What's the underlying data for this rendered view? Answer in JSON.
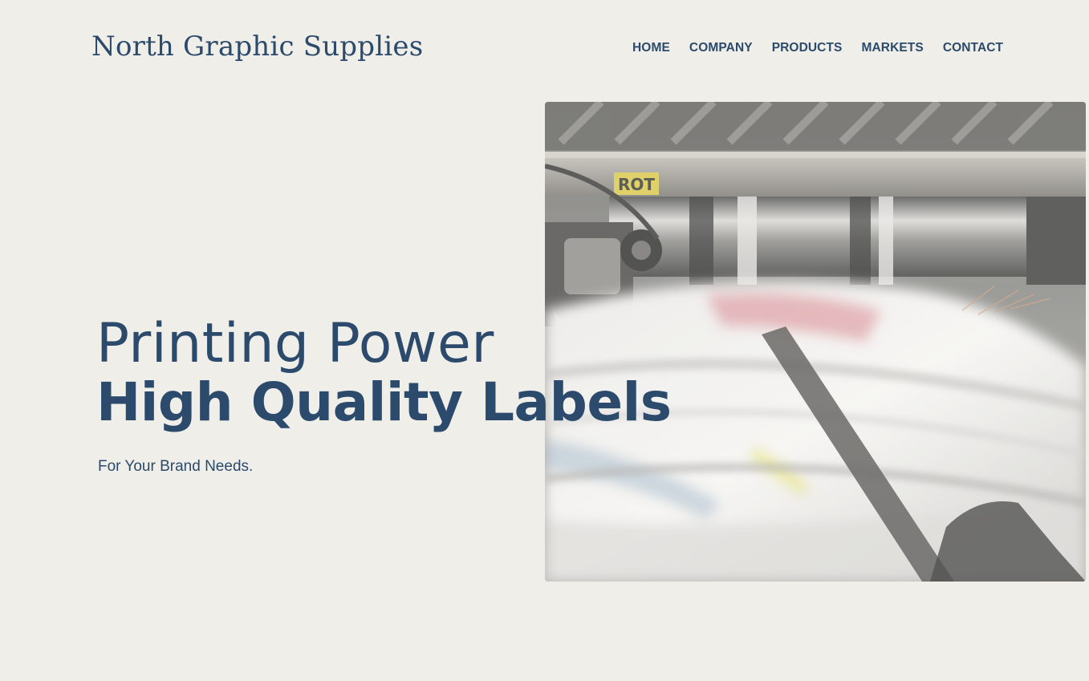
{
  "header": {
    "logo": "North Graphic Supplies",
    "nav": [
      {
        "label": "HOME"
      },
      {
        "label": "COMPANY"
      },
      {
        "label": "PRODUCTS"
      },
      {
        "label": "MARKETS"
      },
      {
        "label": "CONTACT"
      }
    ]
  },
  "hero": {
    "line1": "Printing Power",
    "line2": "High Quality Labels",
    "subtitle": "For Your Brand Needs.",
    "image_caption_text": "ROT"
  },
  "colors": {
    "background": "#efeee8",
    "brand": "#2c4a6b"
  }
}
